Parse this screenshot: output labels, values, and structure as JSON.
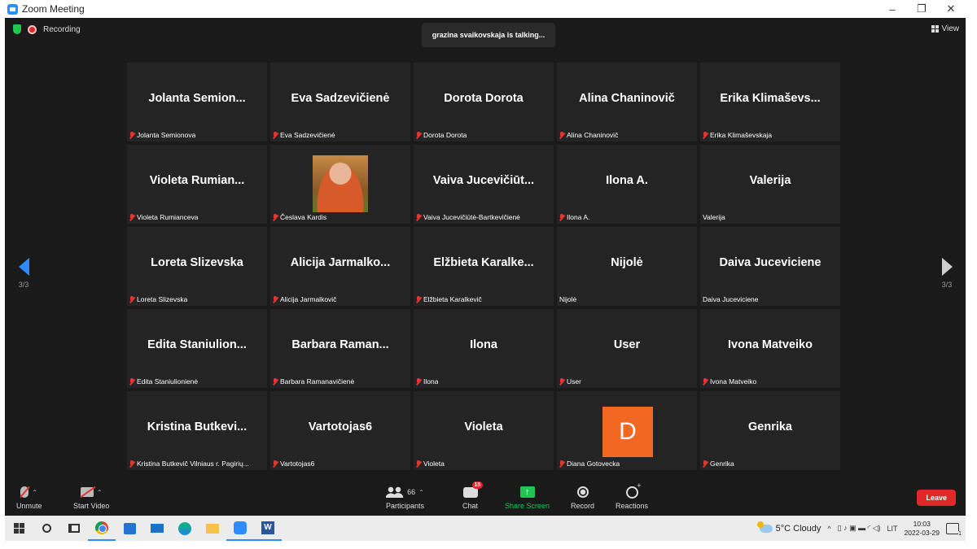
{
  "window": {
    "title": "Zoom Meeting",
    "minimize": "–",
    "restore": "❐",
    "close": "✕"
  },
  "header": {
    "recording": "Recording",
    "talking": "grazina svaikovskaja is talking...",
    "view": "View"
  },
  "pager": {
    "left": "3/3",
    "right": "3/3"
  },
  "tiles": [
    {
      "big": "Jolanta  Semion...",
      "name": "Jolanta Semionova",
      "muted": true
    },
    {
      "big": "Eva Sadzevičienė",
      "name": "Eva Sadzevičienė",
      "muted": true
    },
    {
      "big": "Dorota Dorota",
      "name": "Dorota Dorota",
      "muted": true
    },
    {
      "big": "Alina Chaninovič",
      "name": "Alina Chaninovič",
      "muted": true
    },
    {
      "big": "Erika  Klimaševs...",
      "name": "Erika Klimaševskaja",
      "muted": true
    },
    {
      "big": "Violeta  Rumian...",
      "name": "Violeta Rumianceva",
      "muted": true
    },
    {
      "big": "",
      "name": "Česlava Kardis",
      "muted": true,
      "photo": true
    },
    {
      "big": "Vaiva  Jucevičiūt...",
      "name": "Vaiva Jucevičiūtė-Bartkevičienė",
      "muted": true
    },
    {
      "big": "Ilona A.",
      "name": "Ilona A.",
      "muted": true
    },
    {
      "big": "Valerija",
      "name": "Valerija",
      "muted": false
    },
    {
      "big": "Loreta Slizevska",
      "name": "Loreta Slizevska",
      "muted": true
    },
    {
      "big": "Alicija  Jarmalko...",
      "name": "Alicija Jarmalkovič",
      "muted": true
    },
    {
      "big": "Elžbieta  Karalke...",
      "name": "Elžbieta Karalkevič",
      "muted": true
    },
    {
      "big": "Nijolė",
      "name": "Nijolė",
      "muted": false
    },
    {
      "big": "Daiva Juceviciene",
      "name": "Daiva Juceviciene",
      "muted": false
    },
    {
      "big": "Edita  Staniulion...",
      "name": "Edita Staniulionienė",
      "muted": true
    },
    {
      "big": "Barbara  Raman...",
      "name": "Barbara Ramanavičienė",
      "muted": true
    },
    {
      "big": "Ilona",
      "name": "Ilona",
      "muted": true
    },
    {
      "big": "User",
      "name": "User",
      "muted": true
    },
    {
      "big": "Ivona Matveiko",
      "name": "Ivona Matveiko",
      "muted": true
    },
    {
      "big": "Kristina  Butkevi...",
      "name": "Kristina Butkevič Vilniaus r. Pagirių...",
      "muted": true
    },
    {
      "big": "Vartotojas6",
      "name": "Vartotojas6",
      "muted": true
    },
    {
      "big": "Violeta",
      "name": "Violeta",
      "muted": true
    },
    {
      "big": "",
      "name": "Diana Gotovecka",
      "muted": true,
      "avatar": "D"
    },
    {
      "big": "Genrika",
      "name": "Genrika",
      "muted": true
    }
  ],
  "toolbar": {
    "unmute": "Unmute",
    "start_video": "Start Video",
    "participants": "Participants",
    "participants_count": "66",
    "chat": "Chat",
    "chat_badge": "15",
    "share": "Share Screen",
    "record": "Record",
    "reactions": "Reactions",
    "leave": "Leave"
  },
  "taskbar": {
    "weather": "5°C  Cloudy",
    "lang": "LIT",
    "time": "10:03",
    "date": "2022-03-29",
    "notifications": "1"
  },
  "colors": {
    "zoom_blue": "#2d8cff",
    "leave_red": "#e02828",
    "share_green": "#23c552",
    "avatar_orange": "#f26722"
  }
}
